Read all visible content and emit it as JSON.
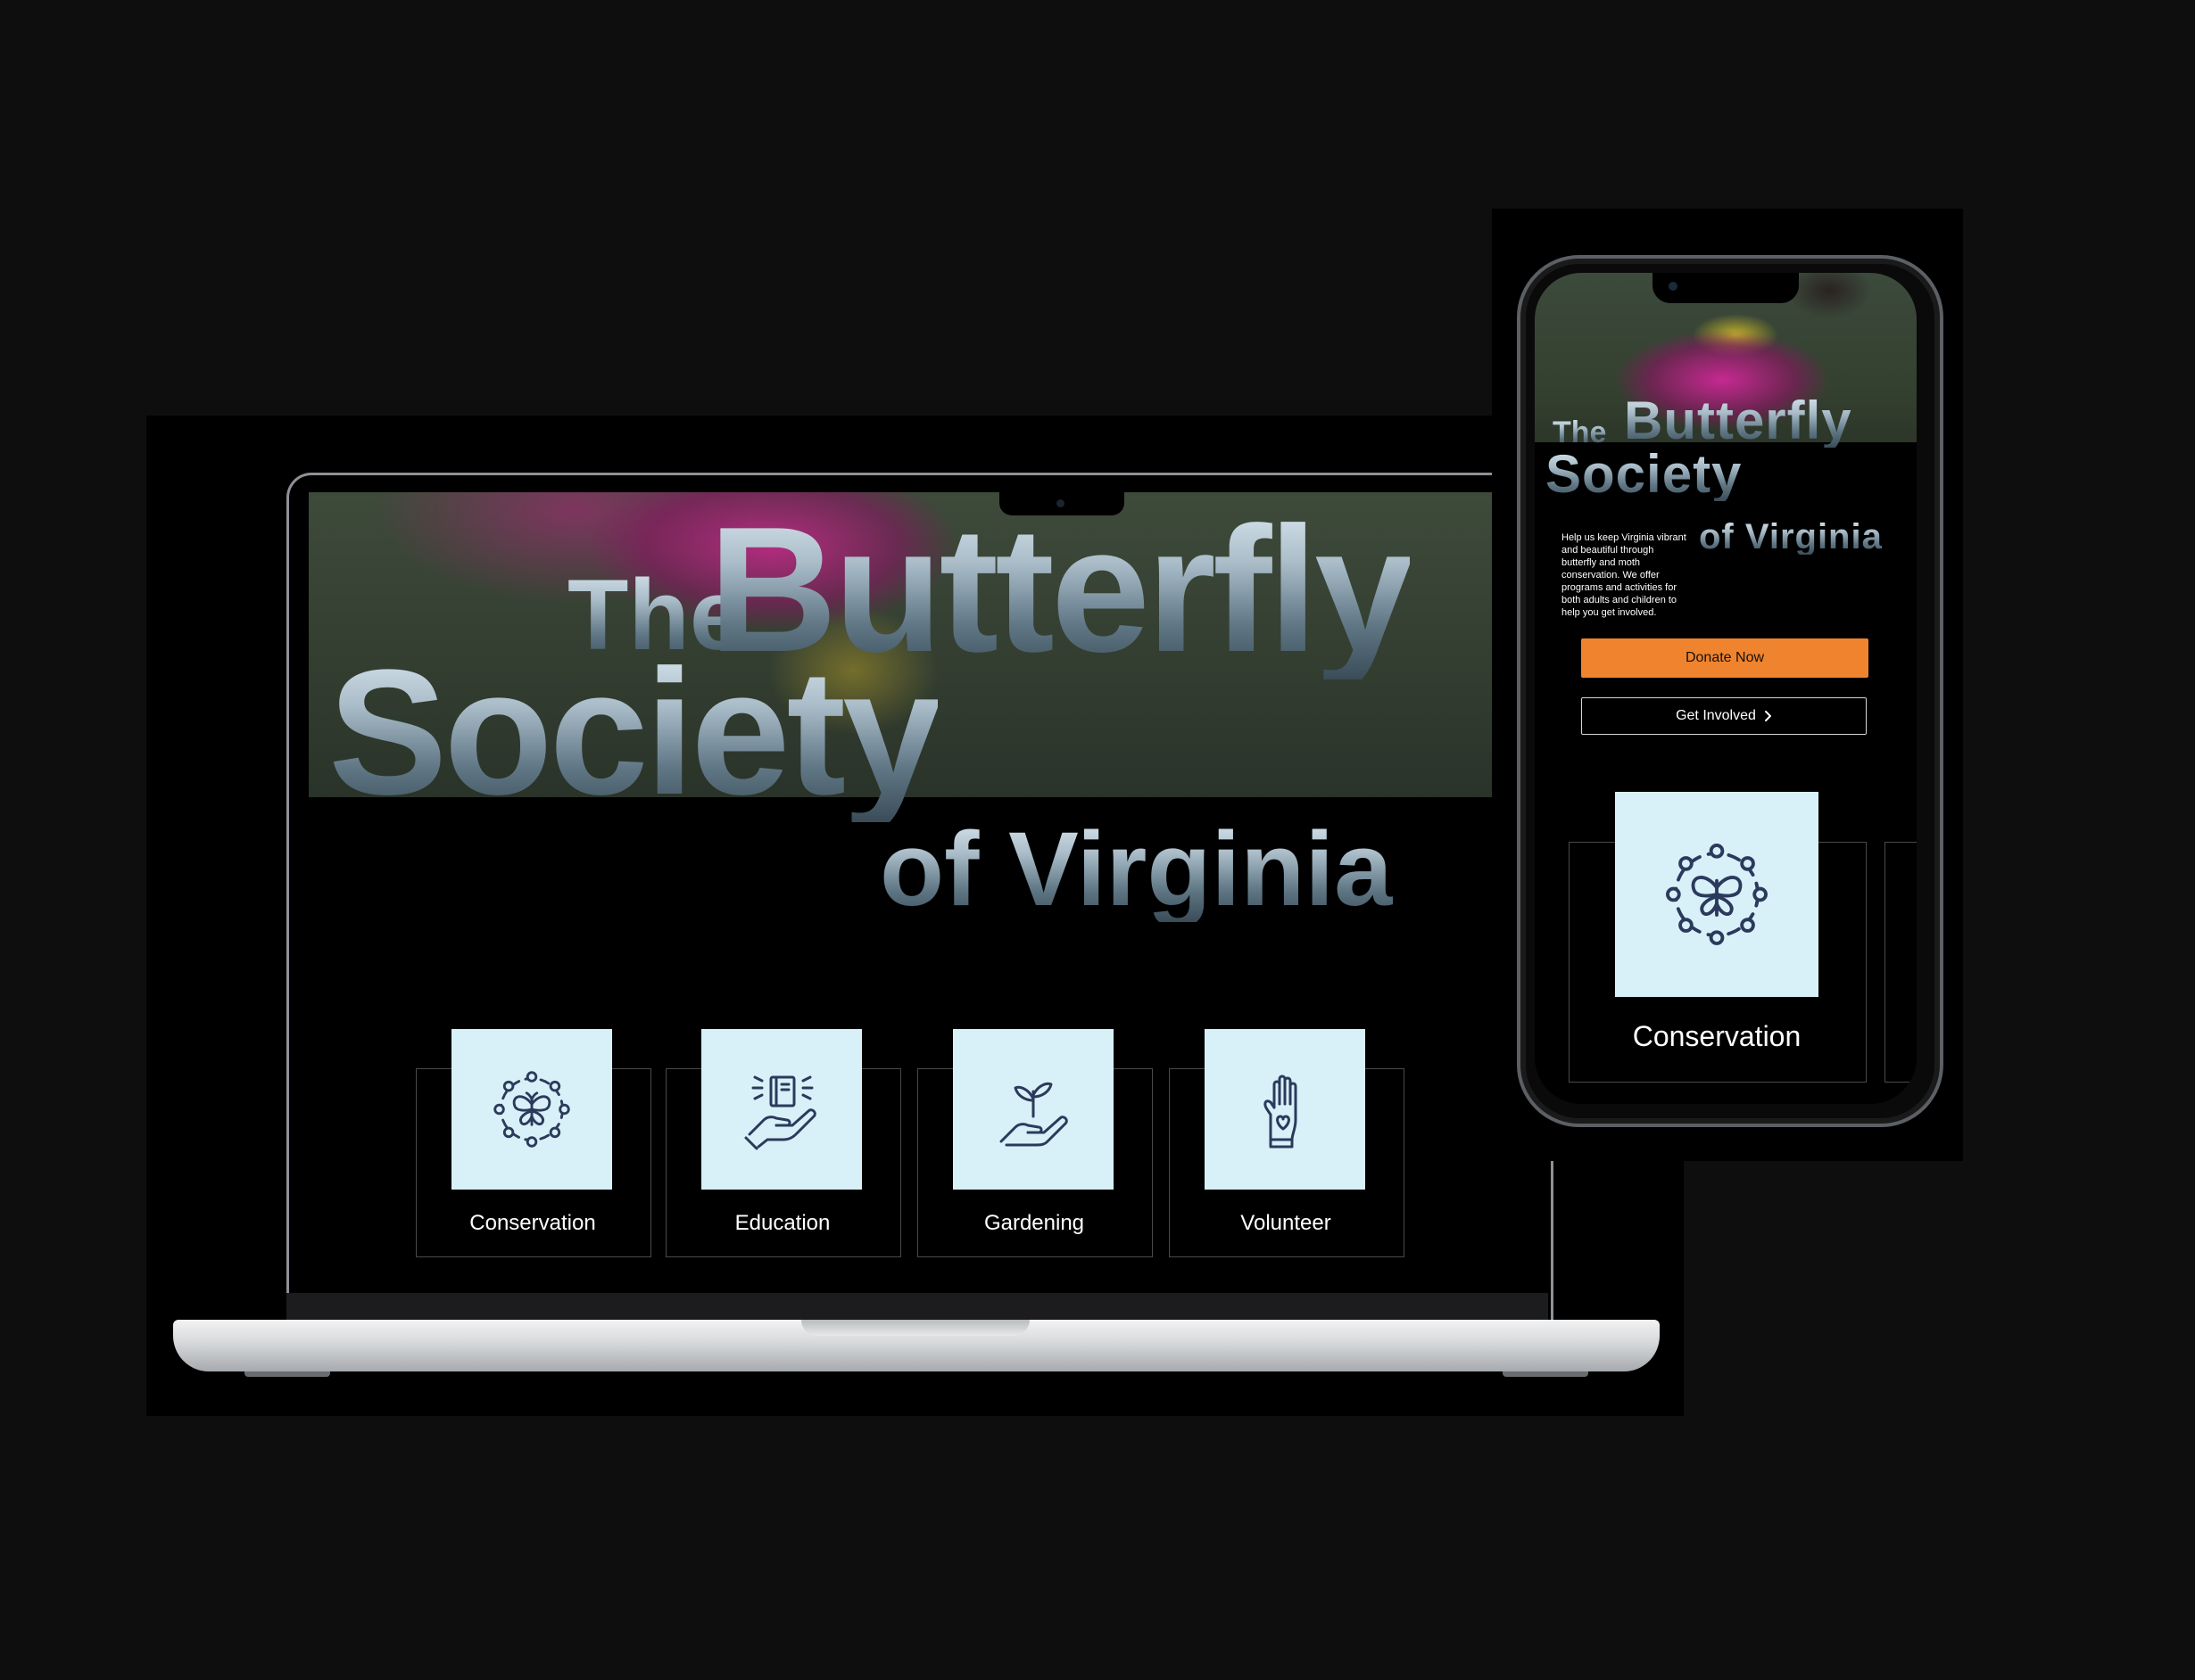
{
  "brand": {
    "title_the": "The",
    "title_butterfly": "Butterfly",
    "title_society": "Society",
    "title_virginia": "of Virginia"
  },
  "laptop": {
    "cards": [
      {
        "label": "Conservation",
        "icon": "butterfly-wreath-icon"
      },
      {
        "label": "Education",
        "icon": "book-in-hand-icon"
      },
      {
        "label": "Gardening",
        "icon": "sprout-in-hand-icon"
      },
      {
        "label": "Volunteer",
        "icon": "hand-heart-icon"
      }
    ]
  },
  "phone": {
    "description": "Help us keep Virginia vibrant and beautiful through butterfly and moth conservation. We offer programs and activities for both adults and children to help you get involved.",
    "donate_label": "Donate Now",
    "involved_label": "Get Involved",
    "card": {
      "label": "Conservation",
      "icon": "butterfly-wreath-icon"
    }
  },
  "colors": {
    "page_background": "#0e0e0e",
    "card_tile": "#d8f1f8",
    "icon_stroke": "#2b3a5c",
    "donate_button": "#f0832d"
  }
}
